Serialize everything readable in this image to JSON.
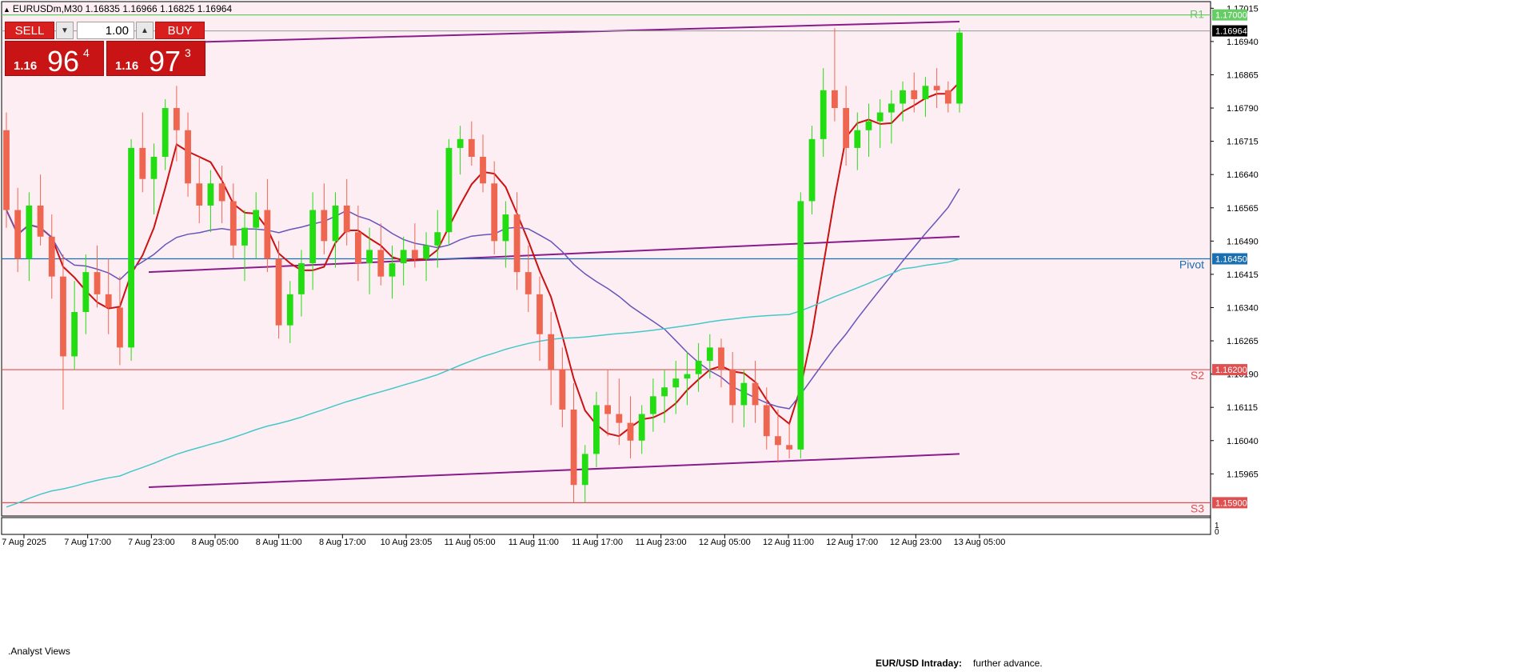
{
  "header": {
    "symbol_info": "EURUSDm,M30  1.16835 1.16966 1.16825 1.16964"
  },
  "trade_panel": {
    "sell_label": "SELL",
    "buy_label": "BUY",
    "lot_value": "1.00",
    "sell_price": {
      "prefix": "1.16",
      "big": "96",
      "sup": "4"
    },
    "buy_price": {
      "prefix": "1.16",
      "big": "97",
      "sup": "3"
    }
  },
  "subwindow": {
    "label": ".Analyst Views",
    "scale_top": "1",
    "scale_bottom": "0"
  },
  "analyst": {
    "title": "EUR/USD Intraday:",
    "text": "further advance."
  },
  "colors": {
    "background": "#fdeef4",
    "bull": "#22dd11",
    "bear": "#ef6650",
    "ma_fast": "#cc1111",
    "ma_mid": "#6655bb",
    "ma_slow": "#44c8c8",
    "channel": "#8b1a8b",
    "r1": "#66cc66",
    "pivot": "#1a6fb0",
    "support": "#e05050"
  },
  "chart_data": {
    "type": "candlestick",
    "symbol": "EURUSDm",
    "timeframe": "M30",
    "ohlc": {
      "open": 1.16835,
      "high": 1.16966,
      "low": 1.16825,
      "close": 1.16964
    },
    "current_price": 1.16964,
    "ylim": [
      1.1587,
      1.1703
    ],
    "y_ticks": [
      "1.17015",
      "1.16940",
      "1.16865",
      "1.16790",
      "1.16715",
      "1.16640",
      "1.16565",
      "1.16490",
      "1.16415",
      "1.16340",
      "1.16265",
      "1.16190",
      "1.16115",
      "1.16040",
      "1.15965"
    ],
    "x_ticks": [
      "7 Aug 2025",
      "7 Aug 17:00",
      "7 Aug 23:00",
      "8 Aug 05:00",
      "8 Aug 11:00",
      "8 Aug 17:00",
      "10 Aug 23:05",
      "11 Aug 05:00",
      "11 Aug 11:00",
      "11 Aug 17:00",
      "11 Aug 23:00",
      "12 Aug 05:00",
      "12 Aug 11:00",
      "12 Aug 17:00",
      "12 Aug 23:00",
      "13 Aug 05:00"
    ],
    "levels": [
      {
        "name": "R1",
        "value": 1.17,
        "label": "1.17000"
      },
      {
        "name": "Pivot",
        "value": 1.1645,
        "label": "1.16450"
      },
      {
        "name": "S2",
        "value": 1.162,
        "label": "1.16200"
      },
      {
        "name": "S3",
        "value": 1.159,
        "label": "1.15900"
      }
    ],
    "candles": [
      [
        1.1674,
        1.1678,
        1.1652,
        1.1656
      ],
      [
        1.1656,
        1.1661,
        1.1642,
        1.1645
      ],
      [
        1.1645,
        1.166,
        1.164,
        1.1657
      ],
      [
        1.1657,
        1.1664,
        1.1648,
        1.165
      ],
      [
        1.165,
        1.1655,
        1.1636,
        1.1641
      ],
      [
        1.1641,
        1.1646,
        1.1611,
        1.1623
      ],
      [
        1.1623,
        1.164,
        1.162,
        1.1633
      ],
      [
        1.1633,
        1.1646,
        1.1628,
        1.1642
      ],
      [
        1.1642,
        1.1648,
        1.1634,
        1.1637
      ],
      [
        1.1637,
        1.1645,
        1.1628,
        1.1634
      ],
      [
        1.1634,
        1.1641,
        1.1621,
        1.1625
      ],
      [
        1.1625,
        1.1672,
        1.1622,
        1.167
      ],
      [
        1.167,
        1.1678,
        1.166,
        1.1663
      ],
      [
        1.1663,
        1.1671,
        1.1655,
        1.1668
      ],
      [
        1.1668,
        1.1681,
        1.1665,
        1.1679
      ],
      [
        1.1679,
        1.1684,
        1.1667,
        1.1674
      ],
      [
        1.1674,
        1.1678,
        1.1659,
        1.1662
      ],
      [
        1.1662,
        1.1668,
        1.1653,
        1.1657
      ],
      [
        1.1657,
        1.1665,
        1.1651,
        1.1662
      ],
      [
        1.1662,
        1.1666,
        1.1653,
        1.1658
      ],
      [
        1.1658,
        1.1662,
        1.1645,
        1.1648
      ],
      [
        1.1648,
        1.1656,
        1.164,
        1.1652
      ],
      [
        1.1652,
        1.166,
        1.1645,
        1.1656
      ],
      [
        1.1656,
        1.1663,
        1.1642,
        1.1645
      ],
      [
        1.1645,
        1.1649,
        1.1627,
        1.163
      ],
      [
        1.163,
        1.164,
        1.1626,
        1.1637
      ],
      [
        1.1637,
        1.1647,
        1.1632,
        1.1644
      ],
      [
        1.1644,
        1.166,
        1.1638,
        1.1656
      ],
      [
        1.1656,
        1.1662,
        1.1646,
        1.1649
      ],
      [
        1.1649,
        1.166,
        1.1643,
        1.1657
      ],
      [
        1.1657,
        1.1663,
        1.1648,
        1.1651
      ],
      [
        1.1651,
        1.1657,
        1.164,
        1.1644
      ],
      [
        1.1644,
        1.1652,
        1.1637,
        1.1647
      ],
      [
        1.1647,
        1.1653,
        1.1639,
        1.1641
      ],
      [
        1.1641,
        1.1648,
        1.1636,
        1.1644
      ],
      [
        1.1644,
        1.165,
        1.1639,
        1.1647
      ],
      [
        1.1647,
        1.1653,
        1.1643,
        1.1645
      ],
      [
        1.1645,
        1.1651,
        1.164,
        1.1648
      ],
      [
        1.1648,
        1.1656,
        1.1643,
        1.1651
      ],
      [
        1.1651,
        1.1672,
        1.1648,
        1.167
      ],
      [
        1.167,
        1.1675,
        1.1664,
        1.1672
      ],
      [
        1.1672,
        1.1676,
        1.1666,
        1.1668
      ],
      [
        1.1668,
        1.1673,
        1.166,
        1.1662
      ],
      [
        1.1662,
        1.1667,
        1.1646,
        1.1649
      ],
      [
        1.1649,
        1.1658,
        1.1643,
        1.1655
      ],
      [
        1.1655,
        1.166,
        1.1638,
        1.1642
      ],
      [
        1.1642,
        1.1648,
        1.1633,
        1.1637
      ],
      [
        1.1637,
        1.1641,
        1.1622,
        1.1628
      ],
      [
        1.1628,
        1.1633,
        1.1612,
        1.162
      ],
      [
        1.162,
        1.1625,
        1.1607,
        1.1611
      ],
      [
        1.1611,
        1.1617,
        1.159,
        1.1594
      ],
      [
        1.1594,
        1.1603,
        1.159,
        1.1601
      ],
      [
        1.1601,
        1.1615,
        1.1598,
        1.1612
      ],
      [
        1.1612,
        1.162,
        1.1605,
        1.161
      ],
      [
        1.161,
        1.1618,
        1.1603,
        1.1608
      ],
      [
        1.1608,
        1.1614,
        1.16,
        1.1604
      ],
      [
        1.1604,
        1.1612,
        1.1601,
        1.161
      ],
      [
        1.161,
        1.1618,
        1.1606,
        1.1614
      ],
      [
        1.1614,
        1.162,
        1.1608,
        1.1616
      ],
      [
        1.1616,
        1.1622,
        1.161,
        1.1618
      ],
      [
        1.1618,
        1.1624,
        1.1612,
        1.1619
      ],
      [
        1.1619,
        1.1626,
        1.1615,
        1.1622
      ],
      [
        1.1622,
        1.1628,
        1.1618,
        1.1625
      ],
      [
        1.1625,
        1.1627,
        1.1616,
        1.162
      ],
      [
        1.162,
        1.1624,
        1.1608,
        1.1612
      ],
      [
        1.1612,
        1.162,
        1.1607,
        1.1617
      ],
      [
        1.1617,
        1.1622,
        1.1608,
        1.1612
      ],
      [
        1.1612,
        1.1616,
        1.1602,
        1.1605
      ],
      [
        1.1605,
        1.1611,
        1.1599,
        1.1603
      ],
      [
        1.1603,
        1.1608,
        1.16,
        1.1602
      ],
      [
        1.1602,
        1.166,
        1.16,
        1.1658
      ],
      [
        1.1658,
        1.1675,
        1.1655,
        1.1672
      ],
      [
        1.1672,
        1.1688,
        1.1668,
        1.1683
      ],
      [
        1.1683,
        1.1697,
        1.1676,
        1.1679
      ],
      [
        1.1679,
        1.1684,
        1.1666,
        1.167
      ],
      [
        1.167,
        1.1678,
        1.1665,
        1.1674
      ],
      [
        1.1674,
        1.168,
        1.1668,
        1.1676
      ],
      [
        1.1676,
        1.1681,
        1.167,
        1.1678
      ],
      [
        1.1678,
        1.1683,
        1.1671,
        1.168
      ],
      [
        1.168,
        1.1685,
        1.1676,
        1.1683
      ],
      [
        1.1683,
        1.1687,
        1.1678,
        1.1681
      ],
      [
        1.1681,
        1.1686,
        1.1677,
        1.1684
      ],
      [
        1.1684,
        1.1688,
        1.1679,
        1.1683
      ],
      [
        1.1683,
        1.1685,
        1.1678,
        1.168
      ],
      [
        1.168,
        1.1697,
        1.1678,
        1.1696
      ]
    ]
  }
}
